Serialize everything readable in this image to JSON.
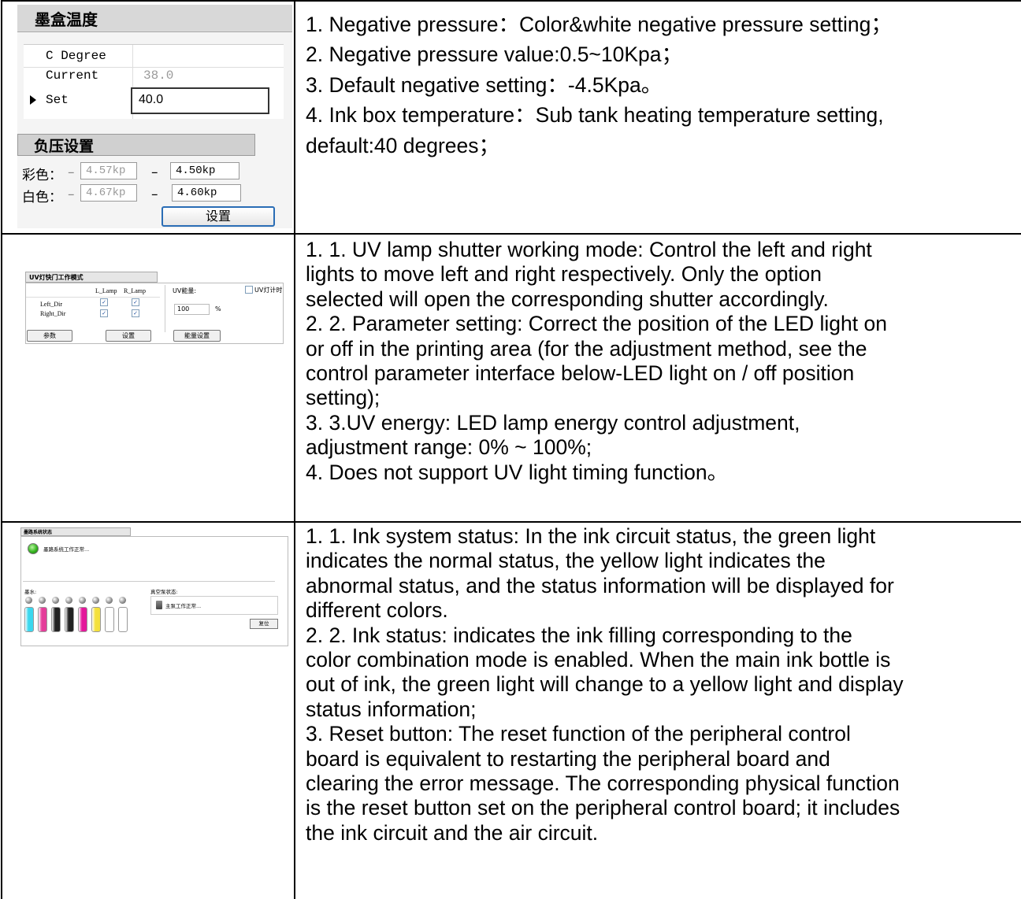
{
  "rows": [
    {
      "lines": [
        "1.  Negative pressure：Color&white negative pressure setting；",
        "2.  Negative pressure value:0.5~10Kpa；",
        "3.  Default negative setting：-4.5Kpa。",
        "4.  Ink box temperature：Sub tank heating temperature setting,",
        "default:40 degrees；"
      ]
    },
    {
      "lines": [
        "1.  1. UV lamp shutter working mode: Control the left and right",
        "lights to move left and right respectively. Only the option",
        "selected will open the corresponding shutter accordingly.",
        "2.  2. Parameter setting: Correct the position of the LED light on",
        "or off in the printing area (for the adjustment method, see the",
        "control parameter interface below-LED light on / off position",
        "setting);",
        "3.  3.UV energy: LED lamp energy control adjustment,",
        "adjustment range: 0% ~ 100%;",
        "4.  Does not support UV light timing function。"
      ]
    },
    {
      "lines": [
        "1.  1. Ink system status: In the ink circuit status, the green light",
        "indicates the normal status, the yellow light indicates the",
        "abnormal status, and the status information will be displayed for",
        "different colors.",
        "2.  2. Ink status: indicates the ink filling corresponding to the",
        "color combination mode is enabled. When the main ink bottle is",
        "out of ink, the green light will change to a yellow light and display",
        "status information;",
        "3.  Reset button: The reset function of the peripheral control",
        "board is equivalent to restarting the peripheral board and",
        "clearing the error message. The corresponding physical function",
        "is the reset button set on the peripheral control board; it includes",
        "the ink circuit and the air circuit."
      ]
    }
  ],
  "panel_ink_temp": {
    "title": "墨盒温度",
    "header": "C Degree",
    "current_label": "Current",
    "current_value": "38.0",
    "set_label": "Set",
    "set_value": "40.0"
  },
  "panel_neg_pressure": {
    "title": "负压设置",
    "color_label": "彩色：",
    "color_current": "4.57kp",
    "color_set": "4.50kp",
    "white_label": "白色：",
    "white_current": "4.67kp",
    "white_set": "4.60kp",
    "dash": "–",
    "set_button": "设置"
  },
  "panel_uv": {
    "title": "UV灯快门工作模式",
    "col_l": "L_Lamp",
    "col_r": "R_Lamp",
    "row_left": "Left_Dir",
    "row_right": "Right_Dir",
    "energy_label": "UV能量:",
    "energy_value": "100",
    "energy_unit": "%",
    "timer_label": "UV灯计时",
    "params_button": "参数",
    "set_button": "设置",
    "energy_button": "能量设置"
  },
  "panel_ink_status": {
    "title": "墨路系统状态",
    "status_text": "墨路系统工作正常...",
    "ink_label": "墨水:",
    "pump_label": "真空泵状态:",
    "pump_text": "主泵工作正常...",
    "reset_button": "复位",
    "bottle_colors": [
      "#3bd7ee",
      "#e43d9a",
      "#222222",
      "#222222",
      "#e4189b",
      "#f4e03a",
      "#ffffff",
      "#ffffff"
    ]
  }
}
